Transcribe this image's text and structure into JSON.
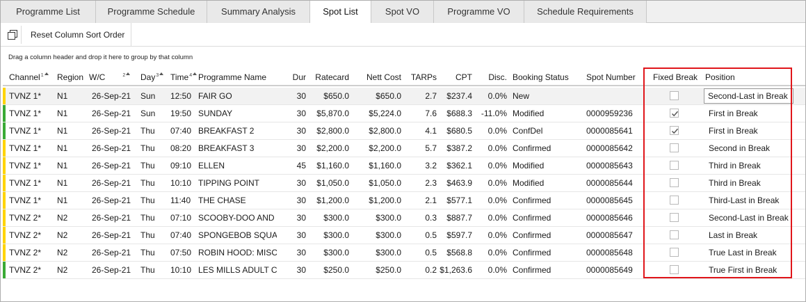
{
  "tabs": [
    {
      "label": "Programme List",
      "active": false
    },
    {
      "label": "Programme Schedule",
      "active": false
    },
    {
      "label": "Summary Analysis",
      "active": false
    },
    {
      "label": "Spot List",
      "active": true
    },
    {
      "label": "Spot VO",
      "active": false
    },
    {
      "label": "Programme VO",
      "active": false
    },
    {
      "label": "Schedule Requirements",
      "active": false
    }
  ],
  "toolbar": {
    "copy_icon": "copy-icon",
    "reset_label": "Reset Column Sort Order"
  },
  "group_panel": {
    "text": "Drag a column header and drop it here to group by that column"
  },
  "columns": {
    "channel": {
      "label": "Channel",
      "sort_index": "1"
    },
    "region": {
      "label": "Region"
    },
    "wc": {
      "label": "W/C",
      "sort_index": "2"
    },
    "day": {
      "label": "Day",
      "sort_index": "3"
    },
    "time": {
      "label": "Time",
      "sort_index": "4"
    },
    "programme": {
      "label": "Programme Name"
    },
    "dur": {
      "label": "Dur"
    },
    "ratecard": {
      "label": "Ratecard"
    },
    "nett": {
      "label": "Nett Cost"
    },
    "tarps": {
      "label": "TARPs"
    },
    "cpt": {
      "label": "CPT"
    },
    "disc": {
      "label": "Disc."
    },
    "status": {
      "label": "Booking Status"
    },
    "spot": {
      "label": "Spot Number"
    },
    "fixed": {
      "label": "Fixed Break"
    },
    "position": {
      "label": "Position"
    }
  },
  "colors": {
    "yellow_indicator": "#ffd400",
    "green_indicator": "#3aaa35",
    "highlight": "#e0151a"
  },
  "rows": [
    {
      "channel": "TVNZ 1*",
      "region": "N1",
      "wc": "26-Sep-21",
      "day": "Sun",
      "time": "12:50",
      "programme": "FAIR GO",
      "dur": "30",
      "ratecard": "$650.0",
      "nett": "$650.0",
      "tarps": "2.7",
      "cpt": "$237.4",
      "disc": "0.0%",
      "status": "New",
      "spot": "",
      "fixed": false,
      "position": "Second-Last in Break",
      "indicator": "yellow"
    },
    {
      "channel": "TVNZ 1*",
      "region": "N1",
      "wc": "26-Sep-21",
      "day": "Sun",
      "time": "19:50",
      "programme": "SUNDAY",
      "dur": "30",
      "ratecard": "$5,870.0",
      "nett": "$5,224.0",
      "tarps": "7.6",
      "cpt": "$688.3",
      "disc": "-11.0%",
      "status": "Modified",
      "spot": "0000959236",
      "fixed": true,
      "position": "First in Break",
      "indicator": "green"
    },
    {
      "channel": "TVNZ 1*",
      "region": "N1",
      "wc": "26-Sep-21",
      "day": "Thu",
      "time": "07:40",
      "programme": "BREAKFAST 2",
      "dur": "30",
      "ratecard": "$2,800.0",
      "nett": "$2,800.0",
      "tarps": "4.1",
      "cpt": "$680.5",
      "disc": "0.0%",
      "status": "ConfDel",
      "spot": "0000085641",
      "fixed": true,
      "position": "First in Break",
      "indicator": "green"
    },
    {
      "channel": "TVNZ 1*",
      "region": "N1",
      "wc": "26-Sep-21",
      "day": "Thu",
      "time": "08:20",
      "programme": "BREAKFAST 3",
      "dur": "30",
      "ratecard": "$2,200.0",
      "nett": "$2,200.0",
      "tarps": "5.7",
      "cpt": "$387.2",
      "disc": "0.0%",
      "status": "Confirmed",
      "spot": "0000085642",
      "fixed": false,
      "position": "Second in Break",
      "indicator": "yellow"
    },
    {
      "channel": "TVNZ 1*",
      "region": "N1",
      "wc": "26-Sep-21",
      "day": "Thu",
      "time": "09:10",
      "programme": "ELLEN",
      "dur": "45",
      "ratecard": "$1,160.0",
      "nett": "$1,160.0",
      "tarps": "3.2",
      "cpt": "$362.1",
      "disc": "0.0%",
      "status": "Modified",
      "spot": "0000085643",
      "fixed": false,
      "position": "Third in Break",
      "indicator": "yellow"
    },
    {
      "channel": "TVNZ 1*",
      "region": "N1",
      "wc": "26-Sep-21",
      "day": "Thu",
      "time": "10:10",
      "programme": "TIPPING POINT",
      "dur": "30",
      "ratecard": "$1,050.0",
      "nett": "$1,050.0",
      "tarps": "2.3",
      "cpt": "$463.9",
      "disc": "0.0%",
      "status": "Modified",
      "spot": "0000085644",
      "fixed": false,
      "position": "Third in Break",
      "indicator": "yellow"
    },
    {
      "channel": "TVNZ 1*",
      "region": "N1",
      "wc": "26-Sep-21",
      "day": "Thu",
      "time": "11:40",
      "programme": "THE CHASE",
      "dur": "30",
      "ratecard": "$1,200.0",
      "nett": "$1,200.0",
      "tarps": "2.1",
      "cpt": "$577.1",
      "disc": "0.0%",
      "status": "Confirmed",
      "spot": "0000085645",
      "fixed": false,
      "position": "Third-Last in Break",
      "indicator": "yellow"
    },
    {
      "channel": "TVNZ 2*",
      "region": "N2",
      "wc": "26-Sep-21",
      "day": "Thu",
      "time": "07:10",
      "programme": "SCOOBY-DOO AND (",
      "dur": "30",
      "ratecard": "$300.0",
      "nett": "$300.0",
      "tarps": "0.3",
      "cpt": "$887.7",
      "disc": "0.0%",
      "status": "Confirmed",
      "spot": "0000085646",
      "fixed": false,
      "position": "Second-Last in Break",
      "indicator": "yellow"
    },
    {
      "channel": "TVNZ 2*",
      "region": "N2",
      "wc": "26-Sep-21",
      "day": "Thu",
      "time": "07:40",
      "programme": "SPONGEBOB SQUARI",
      "dur": "30",
      "ratecard": "$300.0",
      "nett": "$300.0",
      "tarps": "0.5",
      "cpt": "$597.7",
      "disc": "0.0%",
      "status": "Confirmed",
      "spot": "0000085647",
      "fixed": false,
      "position": "Last in Break",
      "indicator": "yellow"
    },
    {
      "channel": "TVNZ 2*",
      "region": "N2",
      "wc": "26-Sep-21",
      "day": "Thu",
      "time": "07:50",
      "programme": "ROBIN HOOD: MISCH",
      "dur": "30",
      "ratecard": "$300.0",
      "nett": "$300.0",
      "tarps": "0.5",
      "cpt": "$568.8",
      "disc": "0.0%",
      "status": "Confirmed",
      "spot": "0000085648",
      "fixed": false,
      "position": "True Last in Break",
      "indicator": "yellow"
    },
    {
      "channel": "TVNZ 2*",
      "region": "N2",
      "wc": "26-Sep-21",
      "day": "Thu",
      "time": "10:10",
      "programme": "LES MILLS ADULT CL",
      "dur": "30",
      "ratecard": "$250.0",
      "nett": "$250.0",
      "tarps": "0.2",
      "cpt": "$1,263.6",
      "disc": "0.0%",
      "status": "Confirmed",
      "spot": "0000085649",
      "fixed": false,
      "position": "True First in Break",
      "indicator": "green"
    }
  ]
}
